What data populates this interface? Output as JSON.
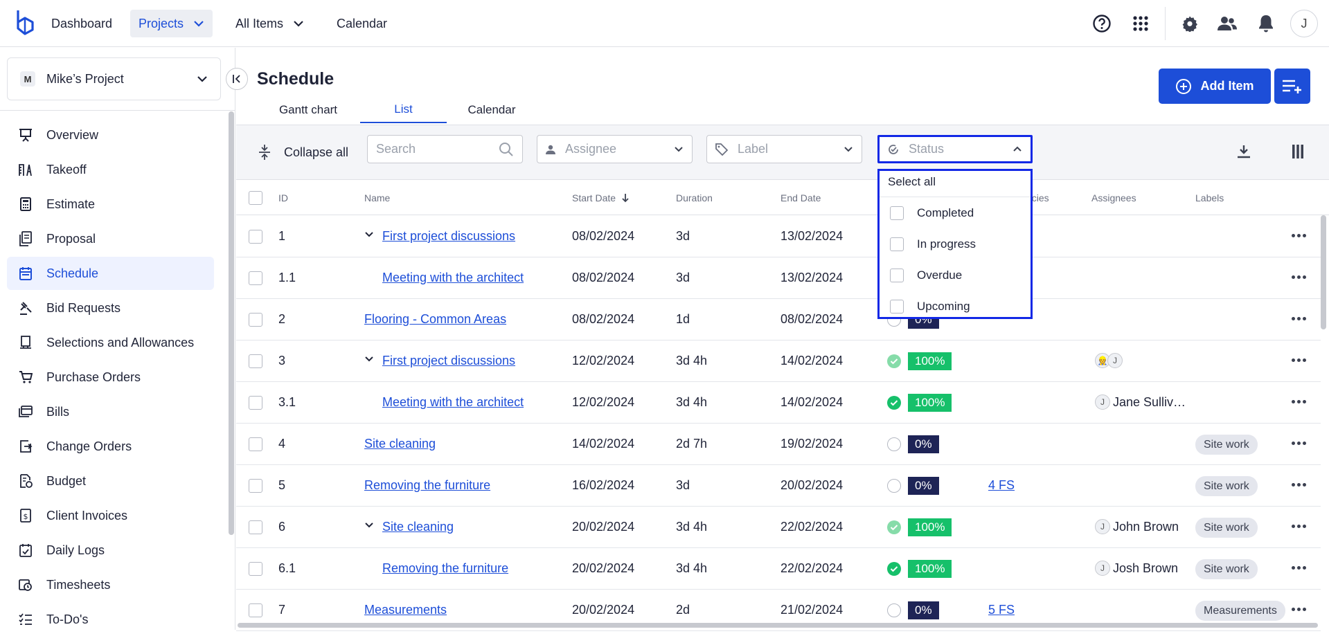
{
  "topnav": {
    "dashboard": "Dashboard",
    "projects": "Projects",
    "all_items": "All Items",
    "calendar": "Calendar",
    "user_initial": "J",
    "icons": [
      "help-icon",
      "apps-grid-icon",
      "settings-icon",
      "team-icon",
      "bell-icon"
    ]
  },
  "sidebar": {
    "project": {
      "badge": "M",
      "name": "Mike’s Project"
    },
    "items": [
      {
        "label": "Overview",
        "icon": "presentation-icon"
      },
      {
        "label": "Takeoff",
        "icon": "takeoff-icon"
      },
      {
        "label": "Estimate",
        "icon": "calculator-icon"
      },
      {
        "label": "Proposal",
        "icon": "proposal-icon"
      },
      {
        "label": "Schedule",
        "icon": "calendar-icon",
        "active": true
      },
      {
        "label": "Bid Requests",
        "icon": "gavel-icon"
      },
      {
        "label": "Selections and Allowances",
        "icon": "selections-icon"
      },
      {
        "label": "Purchase Orders",
        "icon": "cart-icon"
      },
      {
        "label": "Bills",
        "icon": "bills-icon"
      },
      {
        "label": "Change Orders",
        "icon": "change-order-icon"
      },
      {
        "label": "Budget",
        "icon": "budget-icon"
      },
      {
        "label": "Client Invoices",
        "icon": "invoice-icon"
      },
      {
        "label": "Daily Logs",
        "icon": "daily-log-icon"
      },
      {
        "label": "Timesheets",
        "icon": "timesheet-icon"
      },
      {
        "label": "To-Do's",
        "icon": "todo-icon"
      }
    ]
  },
  "page": {
    "title": "Schedule",
    "tabs": [
      "Gantt chart",
      "List",
      "Calendar"
    ],
    "active_tab": "List",
    "add_item": "Add Item"
  },
  "toolbar": {
    "collapse_all": "Collapse all",
    "search_placeholder": "Search",
    "assignee": "Assignee",
    "label": "Label",
    "status": "Status"
  },
  "table": {
    "headers": {
      "id": "ID",
      "name": "Name",
      "start": "Start Date",
      "duration": "Duration",
      "end": "End Date",
      "dependencies": "ncies",
      "assignees": "Assignees",
      "labels": "Labels"
    },
    "rows": [
      {
        "id": "1",
        "name": "First project discussions",
        "start": "08/02/2024",
        "duration": "3d",
        "end": "13/02/2024",
        "status": "",
        "progress": "",
        "dep": "",
        "assignee": "",
        "label": ""
      },
      {
        "id": "1.1",
        "name": "Meeting with the architect",
        "start": "08/02/2024",
        "duration": "3d",
        "end": "13/02/2024",
        "status": "",
        "progress": "",
        "dep": "",
        "assignee": "",
        "label": ""
      },
      {
        "id": "2",
        "name": "Flooring - Common Areas",
        "start": "08/02/2024",
        "duration": "1d",
        "end": "08/02/2024",
        "status": "empty",
        "progress": "0%",
        "dep": "",
        "assignee": "",
        "label": ""
      },
      {
        "id": "3",
        "name": "First project discussions",
        "start": "12/02/2024",
        "duration": "3d 4h",
        "end": "14/02/2024",
        "status": "light",
        "progress": "100%",
        "dep": "",
        "assignee": "J",
        "label": ""
      },
      {
        "id": "3.1",
        "name": "Meeting with the architect",
        "start": "12/02/2024",
        "duration": "3d 4h",
        "end": "14/02/2024",
        "status": "done",
        "progress": "100%",
        "dep": "",
        "assignee": "Jane Sulliv…",
        "label": ""
      },
      {
        "id": "4",
        "name": "Site cleaning",
        "start": "14/02/2024",
        "duration": "2d 7h",
        "end": "19/02/2024",
        "status": "empty",
        "progress": "0%",
        "dep": "",
        "assignee": "",
        "label": "Site work"
      },
      {
        "id": "5",
        "name": "Removing the furniture",
        "start": "16/02/2024",
        "duration": "3d",
        "end": "20/02/2024",
        "status": "empty",
        "progress": "0%",
        "dep": "4 FS",
        "assignee": "",
        "label": "Site work"
      },
      {
        "id": "6",
        "name": "Site cleaning",
        "start": "20/02/2024",
        "duration": "3d 4h",
        "end": "22/02/2024",
        "status": "light",
        "progress": "100%",
        "dep": "",
        "assignee": "John Brown",
        "label": "Site work"
      },
      {
        "id": "6.1",
        "name": "Removing the furniture",
        "start": "20/02/2024",
        "duration": "3d 4h",
        "end": "22/02/2024",
        "status": "done",
        "progress": "100%",
        "dep": "",
        "assignee": "Josh Brown",
        "label": "Site work"
      },
      {
        "id": "7",
        "name": "Measurements",
        "start": "20/02/2024",
        "duration": "2d",
        "end": "21/02/2024",
        "status": "empty",
        "progress": "0%",
        "dep": "5 FS",
        "assignee": "",
        "label": "Measurements"
      }
    ]
  },
  "status_dropdown": {
    "select_all": "Select all",
    "options": [
      "Completed",
      "In progress",
      "Overdue",
      "Upcoming"
    ]
  },
  "colors": {
    "accent": "#1d4ed8",
    "highlight": "#1228e6",
    "progress_done": "#16c06a",
    "progress_zero": "#1e2456"
  }
}
